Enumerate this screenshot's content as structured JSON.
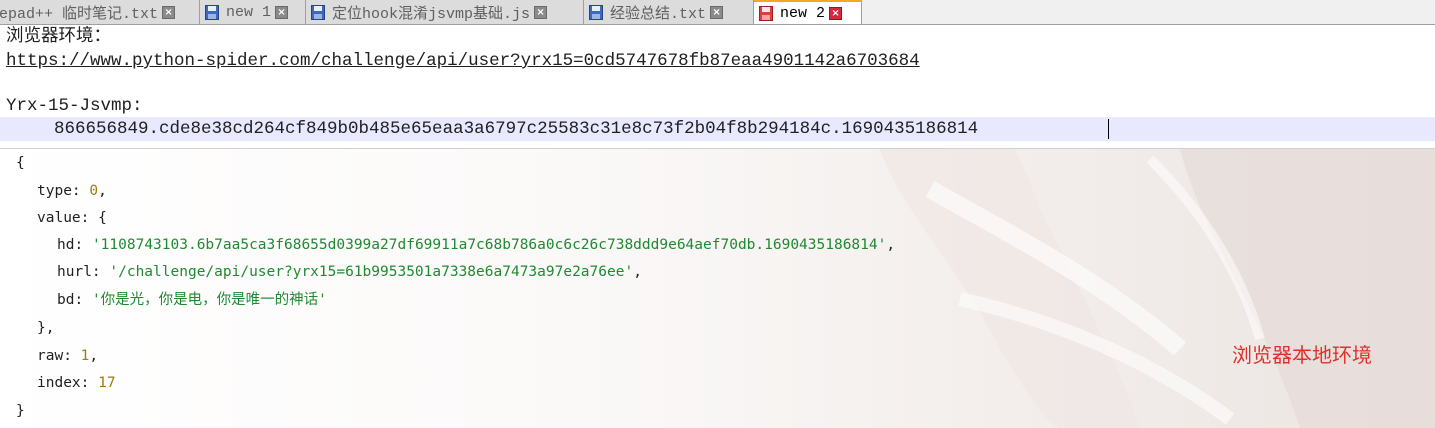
{
  "tabs": [
    {
      "label": "epad++ 临时笔记.txt",
      "active": false,
      "icon": "notepad-file-icon"
    },
    {
      "label": "new 1",
      "active": false,
      "icon": "floppy-saved-icon"
    },
    {
      "label": "定位hook混淆jsvmp基础.js",
      "active": false,
      "icon": "floppy-saved-icon"
    },
    {
      "label": "经验总结.txt",
      "active": false,
      "icon": "floppy-saved-icon"
    },
    {
      "label": "new 2",
      "active": true,
      "icon": "floppy-unsaved-icon"
    }
  ],
  "editor": {
    "line1": "浏览器环境：",
    "line2": "https://www.python-spider.com/challenge/api/user?yrx15=0cd5747678fb87eaa4901142a6703684",
    "line3": "",
    "line4": "Yrx-15-Jsvmp:",
    "line5": "866656849.cde8e38cd264cf849b0b485e65eaa3a6797c25583c31e8c73f2b04f8b294184c.1690435186814"
  },
  "console": {
    "open_brace": "{",
    "type_key": "type",
    "type_value": "0",
    "value_key": "value",
    "hd_key": "hd",
    "hd_value": "'1108743103.6b7aa5ca3f68655d0399a27df69911a7c68b786a0c6c26c738ddd9e64aef70db.1690435186814'",
    "hurl_key": "hurl",
    "hurl_value": "'/challenge/api/user?yrx15=61b9953501a7338e6a7473a97e2a76ee'",
    "bd_key": "bd",
    "bd_value": "'你是光，你是电，你是唯一的神话'",
    "value_close": "},",
    "raw_key": "raw",
    "raw_value": "1",
    "index_key": "index",
    "index_value": "17",
    "close_brace": "}",
    "annotation": "浏览器本地环境"
  },
  "colors": {
    "accent_tab": "#f5a623",
    "close_active": "#d7263d",
    "string": "#1e8a32",
    "number": "#a07a10",
    "annotation": "#e0302a",
    "current_line": "#e8e8ff"
  }
}
